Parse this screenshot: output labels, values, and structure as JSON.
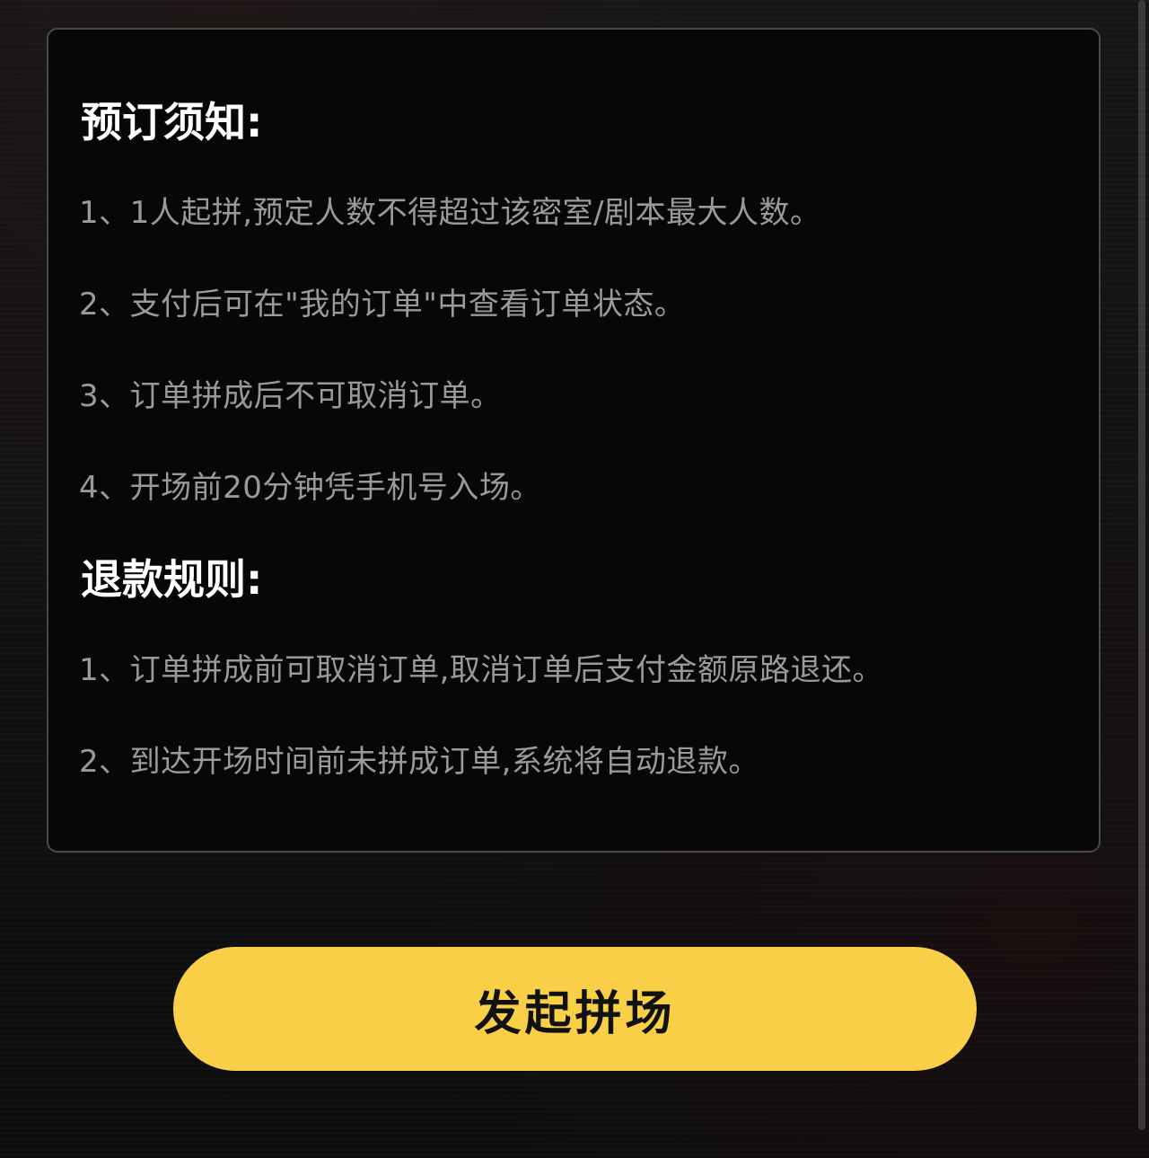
{
  "booking_notice": {
    "title": "预订须知:",
    "items": [
      "1、1人起拼,预定人数不得超过该密室/剧本最大人数。",
      "2、支付后可在\"我的订单\"中查看订单状态。",
      "3、订单拼成后不可取消订单。",
      "4、开场前20分钟凭手机号入场。"
    ]
  },
  "refund_rules": {
    "title": "退款规则:",
    "items": [
      "1、订单拼成前可取消订单,取消订单后支付金额原路退还。",
      "2、到达开场时间前未拼成订单,系统将自动退款。"
    ]
  },
  "action": {
    "start_group_label": "发起拼场"
  },
  "colors": {
    "accent_button": "#f8cf47",
    "card_background": "#070707",
    "card_border": "#4a4a4a",
    "title_text": "#ffffff",
    "body_text": "#9a9a9a"
  }
}
